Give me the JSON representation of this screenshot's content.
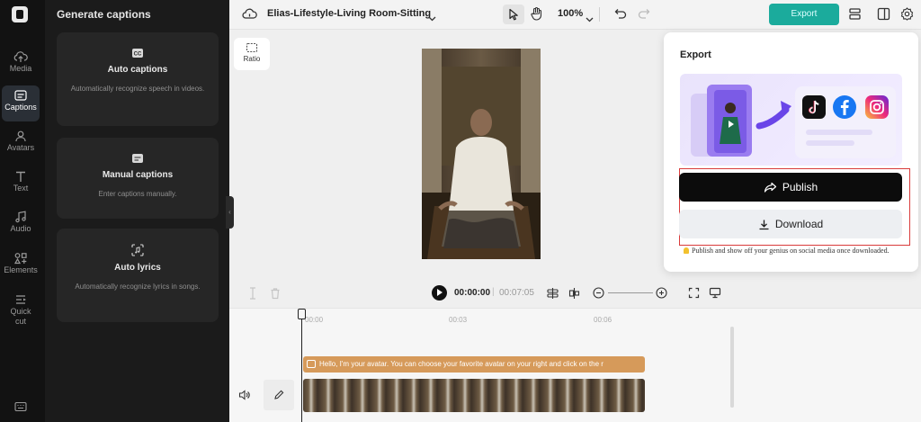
{
  "nav": {
    "items": [
      {
        "label": "Media",
        "icon": "cloud-upload-icon"
      },
      {
        "label": "Captions",
        "icon": "captions-icon",
        "active": true
      },
      {
        "label": "Avatars",
        "icon": "avatar-icon"
      },
      {
        "label": "Text",
        "icon": "text-icon"
      },
      {
        "label": "Audio",
        "icon": "music-note-icon"
      },
      {
        "label": "Elements",
        "icon": "elements-icon"
      },
      {
        "label": "Quick",
        "label2": "cut",
        "icon": "quick-cut-icon"
      }
    ]
  },
  "captions_panel": {
    "title": "Generate captions",
    "options": [
      {
        "title": "Auto captions",
        "description": "Automatically recognize speech in videos."
      },
      {
        "title": "Manual captions",
        "description": "Enter captions manually."
      },
      {
        "title": "Auto lyrics",
        "description": "Automatically recognize lyrics in songs."
      }
    ]
  },
  "topbar": {
    "project_title": "Elias-Lifestyle-Living Room-Sitting",
    "zoom": "100%",
    "export_label": "Export",
    "export_color": "#1bab9c"
  },
  "canvas": {
    "ratio_label": "Ratio"
  },
  "playback": {
    "current_time": "00:00:00",
    "separator": "|",
    "duration": "00:07:05"
  },
  "timeline": {
    "ticks": [
      "00:00",
      "00:03",
      "00:06"
    ],
    "caption_clip_text": "Hello, I'm your avatar. You can choose your favorite avatar on your right and click on the r"
  },
  "export_popover": {
    "title": "Export",
    "publish_label": "Publish",
    "download_label": "Download",
    "tip": "Publish and show off your genius on social media once downloaded.",
    "social_icons": [
      "tiktok-icon",
      "facebook-icon",
      "instagram-icon"
    ]
  }
}
